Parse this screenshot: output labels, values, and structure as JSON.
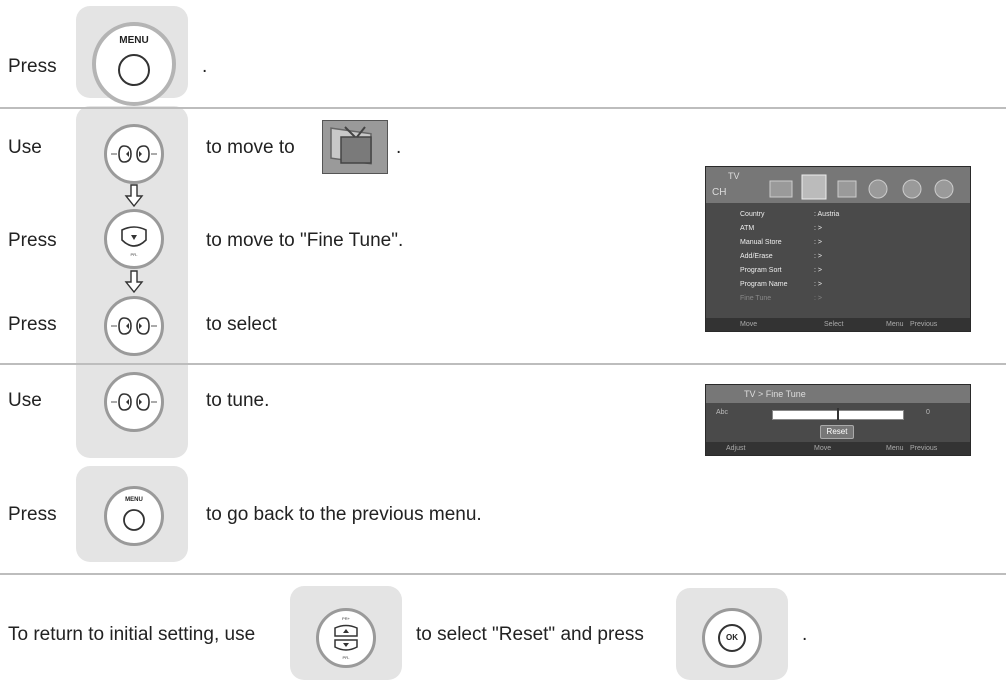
{
  "steps": {
    "s1": {
      "verb": "Press",
      "button_label": "MENU",
      "tail": "."
    },
    "s2": {
      "verb": "Use",
      "text": "to move to",
      "tail": "."
    },
    "s3": {
      "verb": "Press",
      "text": "to move to \"Fine Tune\"."
    },
    "s4": {
      "verb": "Press",
      "text": "to select"
    },
    "s5": {
      "verb": "Use",
      "text": "to tune."
    },
    "s6": {
      "verb": "Press",
      "button_label": "MENU",
      "text": "to go back to the previous menu."
    }
  },
  "reset_row": {
    "text1": "To return to initial setting, use",
    "text2": "to select \"Reset\" and press",
    "ok_label": "OK",
    "tail": "."
  },
  "button_marks": {
    "vol_minus": "VOL-",
    "vol_plus": "VOL+",
    "pr_plus": "PR+",
    "pr_minus": "PR-"
  },
  "tv_menu": {
    "title": "TV",
    "category": "CH",
    "items": [
      {
        "label": "Country",
        "value": ": Austria"
      },
      {
        "label": "ATM",
        "value": ": >"
      },
      {
        "label": "Manual Store",
        "value": ": >"
      },
      {
        "label": "Add/Erase",
        "value": ": >"
      },
      {
        "label": "Program Sort",
        "value": ": >"
      },
      {
        "label": "Program Name",
        "value": ": >"
      },
      {
        "label": "Fine Tune",
        "value": ": >"
      }
    ],
    "footer": {
      "move": "Move",
      "select": "Select",
      "menu": "Menu",
      "previous": "Previous"
    }
  },
  "fine_tune": {
    "breadcrumb": "TV > Fine Tune",
    "channel": "Abc",
    "value": "0",
    "level_fraction": 0.5,
    "reset": "Reset",
    "footer": {
      "adjust": "Adjust",
      "move": "Move",
      "menu": "Menu",
      "previous": "Previous"
    }
  }
}
